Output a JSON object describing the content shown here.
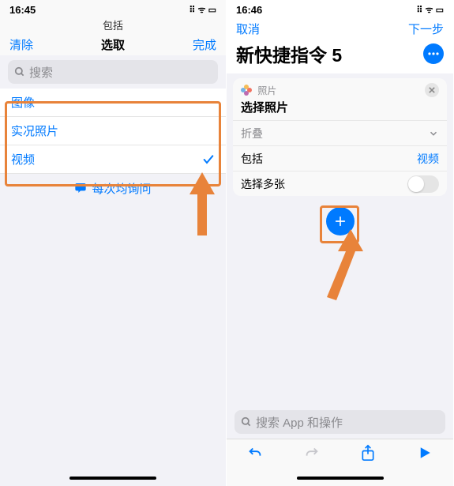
{
  "left": {
    "status": {
      "time": "16:45",
      "icons": "⠿ ᯤ ▭"
    },
    "sub_header": "包括",
    "header": {
      "left": "清除",
      "center": "选取",
      "right": "完成"
    },
    "search_placeholder": "搜索",
    "options": [
      {
        "label": "图像",
        "selected": false
      },
      {
        "label": "实况照片",
        "selected": false
      },
      {
        "label": "视频",
        "selected": true
      }
    ],
    "ask_every_time": "每次均询问"
  },
  "right": {
    "status": {
      "time": "16:46",
      "icons": "⠿ ᯤ ▭"
    },
    "header": {
      "left": "取消",
      "right": "下一步"
    },
    "title": "新快捷指令 5",
    "card": {
      "app_label": "照片",
      "title": "选择照片",
      "rows": [
        {
          "label": "折叠",
          "type": "expand"
        },
        {
          "label": "包括",
          "value": "视频",
          "type": "link"
        },
        {
          "label": "选择多张",
          "type": "toggle",
          "on": false
        }
      ]
    },
    "search_placeholder": "搜索 App 和操作",
    "toolbar": [
      "undo",
      "redo",
      "share",
      "play"
    ]
  },
  "colors": {
    "accent": "#007aff",
    "highlight": "#e8833a"
  }
}
